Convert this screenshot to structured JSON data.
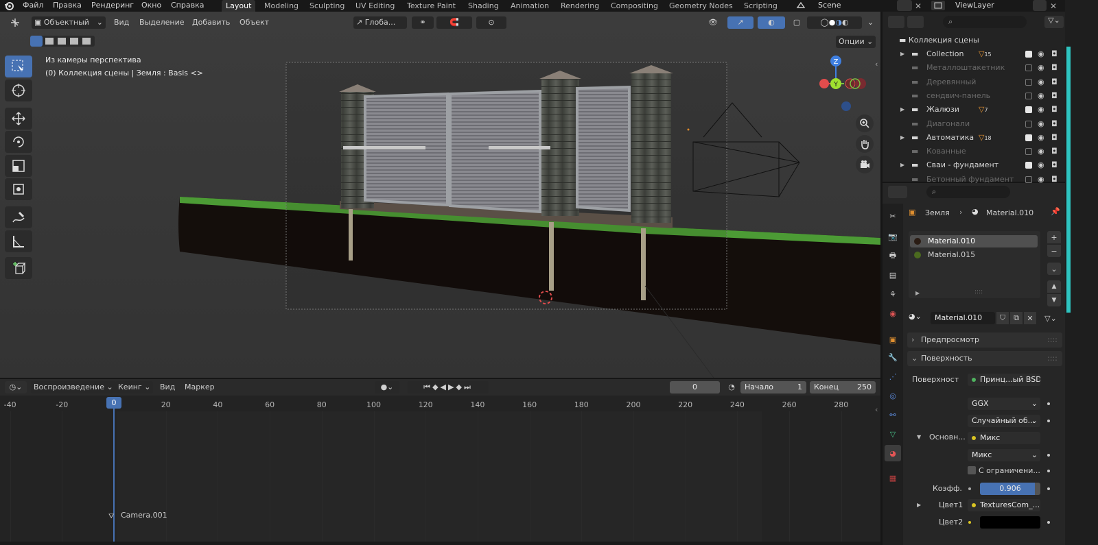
{
  "topbar": {
    "menus": [
      "Файл",
      "Правка",
      "Рендеринг",
      "Окно",
      "Справка"
    ],
    "workspaces": [
      "Layout",
      "Modeling",
      "Sculpting",
      "UV Editing",
      "Texture Paint",
      "Shading",
      "Animation",
      "Rendering",
      "Compositing",
      "Geometry Nodes",
      "Scripting"
    ],
    "active_workspace": "Layout",
    "scene": "Scene",
    "view_layer": "ViewLayer"
  },
  "viewport": {
    "mode": "Объектный",
    "menus": [
      "Вид",
      "Выделение",
      "Добавить",
      "Объект"
    ],
    "transform_orientation": "Глоба...",
    "options_label": "Опции",
    "overlay_title": "Из камеры перспектива",
    "overlay_subtitle": "(0) Коллекция сцены | Земля : Basis <>",
    "gizmo": {
      "z": "Z",
      "y": "Y"
    }
  },
  "timeline": {
    "playback": "Воспроизведение",
    "keying": "Кеинг",
    "view": "Вид",
    "marker": "Маркер",
    "current_frame": "0",
    "start_label": "Начало",
    "start": "1",
    "end_label": "Конец",
    "end": "250",
    "ruler": [
      "-40",
      "-20",
      "0",
      "20",
      "40",
      "60",
      "80",
      "100",
      "120",
      "140",
      "160",
      "180",
      "200",
      "220",
      "240",
      "260",
      "280"
    ],
    "marker_name": "Camera.001"
  },
  "outliner": {
    "search_placeholder": "",
    "root": "Коллекция сцены",
    "items": [
      {
        "label": "Collection",
        "enabled": true,
        "badge": "15"
      },
      {
        "label": "Металлоштакетник",
        "enabled": false,
        "badge": ""
      },
      {
        "label": "Деревянный",
        "enabled": false,
        "badge": ""
      },
      {
        "label": "сендвич-панель",
        "enabled": false,
        "badge": ""
      },
      {
        "label": "Жалюзи",
        "enabled": true,
        "badge": "7"
      },
      {
        "label": "Диагонали",
        "enabled": false,
        "badge": ""
      },
      {
        "label": "Автоматика",
        "enabled": true,
        "badge": "18"
      },
      {
        "label": "Кованные",
        "enabled": false,
        "badge": ""
      },
      {
        "label": "Сваи - фундамент",
        "enabled": true,
        "badge": ""
      },
      {
        "label": "Бетонный фундамент",
        "enabled": false,
        "badge": ""
      }
    ]
  },
  "properties": {
    "breadcrumb_object": "Земля",
    "breadcrumb_material": "Material.010",
    "slots": [
      "Material.010",
      "Material.015"
    ],
    "material_name": "Material.010",
    "panels": {
      "preview": "Предпросмотр",
      "surface": "Поверхность"
    },
    "surface_label": "Поверхност",
    "surface_value": "Принц...ый BSDF",
    "distribution": "GGX",
    "subsurface": "Случайный об...",
    "base_label": "Основн...",
    "base_value": "Микс",
    "blend_mode": "Микс",
    "clamp_label": "С ограничени...",
    "factor_label": "Коэфф.",
    "factor_value": "0.906",
    "factor": 0.906,
    "color1_label": "Цвет1",
    "color1_value": "TexturesCom_...",
    "color2_label": "Цвет2"
  }
}
